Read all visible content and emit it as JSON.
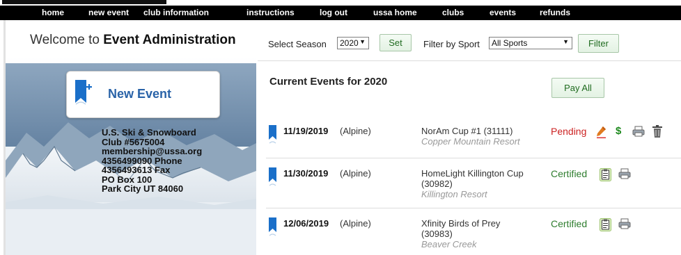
{
  "nav": {
    "items": [
      "home",
      "new event",
      "club information",
      "instructions",
      "log out",
      "ussa home",
      "clubs",
      "events",
      "refunds"
    ]
  },
  "welcome": {
    "prefix": "Welcome to ",
    "bold": "Event Administration"
  },
  "new_event": {
    "label": "New Event",
    "icon": "bookmark-plus-icon"
  },
  "club": {
    "lines": [
      "U.S. Ski & Snowboard",
      "Club #5675004",
      "membership@ussa.org",
      "4356499090 Phone",
      "4356493613 Fax",
      "PO Box 100",
      "Park City  UT  84060"
    ]
  },
  "filters": {
    "season_label": "Select Season",
    "season_value": "2020",
    "set_label": "Set",
    "sport_label": "Filter by Sport",
    "sport_value": "All Sports",
    "filter_label": "Filter"
  },
  "current_title": "Current Events for 2020",
  "pay_all_label": "Pay All",
  "colors": {
    "pending": "#cc2222",
    "certified": "#2e7d2e",
    "bookmark": "#1a6fc9",
    "dollar": "#1f8a1f",
    "pencil": "#e07b20"
  },
  "events": [
    {
      "date": "11/19/2019",
      "discipline": "(Alpine)",
      "name_lines": [
        "NorAm Cup #1 (31111)"
      ],
      "location": "Copper Mountain Resort",
      "status": "Pending",
      "actions": [
        "pencil-icon",
        "dollar-icon",
        "printer-icon",
        "trash-icon"
      ]
    },
    {
      "date": "11/30/2019",
      "discipline": "(Alpine)",
      "name_lines": [
        "HomeLight Killington Cup",
        "(30982)"
      ],
      "location": "Killington Resort",
      "status": "Certified",
      "actions": [
        "clipboard-icon",
        "printer-icon"
      ]
    },
    {
      "date": "12/06/2019",
      "discipline": "(Alpine)",
      "name_lines": [
        "Xfinity Birds of Prey",
        "(30983)"
      ],
      "location": "Beaver Creek",
      "status": "Certified",
      "actions": [
        "clipboard-icon",
        "printer-icon"
      ]
    }
  ]
}
